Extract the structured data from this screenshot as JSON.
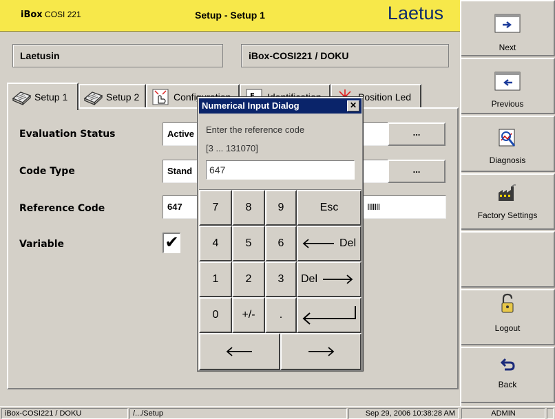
{
  "header": {
    "brand_name": "iBox",
    "brand_model": "COSI 221",
    "title": "Setup - Setup 1",
    "logo": "Laetus"
  },
  "info": {
    "left": "Laetusin",
    "right": "iBox-COSI221 / DOKU"
  },
  "tabs": [
    {
      "label": "Setup 1",
      "icon": "book-icon",
      "active": true
    },
    {
      "label": "Setup 2",
      "icon": "book-icon",
      "active": false
    },
    {
      "label": "Configuration",
      "icon": "hand-pointer-icon",
      "active": false
    },
    {
      "label": "Identification",
      "icon": "id-icon",
      "active": false
    },
    {
      "label": "Position Led",
      "icon": "led-icon",
      "active": false
    }
  ],
  "fields": {
    "evaluation_status": {
      "label": "Evaluation Status",
      "value": "Active",
      "button": "..."
    },
    "code_type": {
      "label": "Code Type",
      "value": "Stand",
      "button": "..."
    },
    "reference_code": {
      "label": "Reference Code",
      "value": "647",
      "barcode": "IIIIIII"
    },
    "variable": {
      "label": "Variable",
      "checked": true,
      "check_glyph": "✔"
    }
  },
  "sidebar": {
    "next": "Next",
    "previous": "Previous",
    "diagnosis": "Diagnosis",
    "factory_settings": "Factory Settings",
    "logout": "Logout",
    "back": "Back"
  },
  "dialog": {
    "title": "Numerical Input Dialog",
    "close": "✕",
    "prompt": "Enter the reference code",
    "range": "[3 ... 131070]",
    "value": "647",
    "keys": {
      "k7": "7",
      "k8": "8",
      "k9": "9",
      "esc": "Esc",
      "k4": "4",
      "k5": "5",
      "k6": "6",
      "back_del": "Del",
      "k1": "1",
      "k2": "2",
      "k3": "3",
      "fwd_del": "Del",
      "k0": "0",
      "sign": "+/-",
      "dot": "."
    }
  },
  "status": {
    "device": "iBox-COSI221 / DOKU",
    "path": "/.../Setup",
    "datetime": "Sep 29, 2006  10:38:28 AM",
    "user": "ADMIN"
  },
  "colors": {
    "header_bg": "#f7e84a",
    "dialog_title_bg": "#0a246a",
    "window_bg": "#d4d0c8"
  }
}
